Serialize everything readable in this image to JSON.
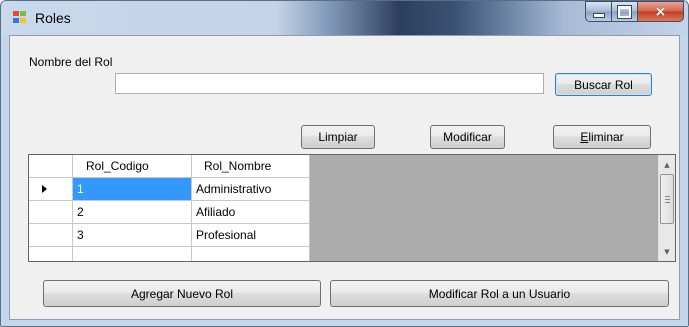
{
  "window": {
    "title": "Roles",
    "icon": "windows-form-icon",
    "controls": {
      "minimize": "minimize-icon",
      "maximize": "maximize-icon",
      "close": "×"
    }
  },
  "form": {
    "nombre_label": "Nombre del Rol",
    "nombre_value": "",
    "buscar_label": "Buscar Rol",
    "limpiar_label": "Limpiar",
    "modificar_label": "Modificar",
    "eliminar_label": "Eliminar",
    "eliminar_mnemonic": "E",
    "eliminar_rest": "liminar"
  },
  "grid": {
    "columns": [
      "Rol_Codigo",
      "Rol_Nombre"
    ],
    "rows": [
      {
        "codigo": "1",
        "nombre": "Administrativo",
        "selected": true
      },
      {
        "codigo": "2",
        "nombre": "Afiliado",
        "selected": false
      },
      {
        "codigo": "3",
        "nombre": "Profesional",
        "selected": false
      }
    ],
    "scroll_up": "▲",
    "scroll_down": "▼"
  },
  "actions": {
    "agregar_label": "Agregar Nuevo Rol",
    "modificar_usuario_label": "Modificar Rol a un Usuario"
  },
  "colors": {
    "selection": "#3399ff",
    "grid_background": "#ababab",
    "focus_border": "#3c7fb1"
  }
}
